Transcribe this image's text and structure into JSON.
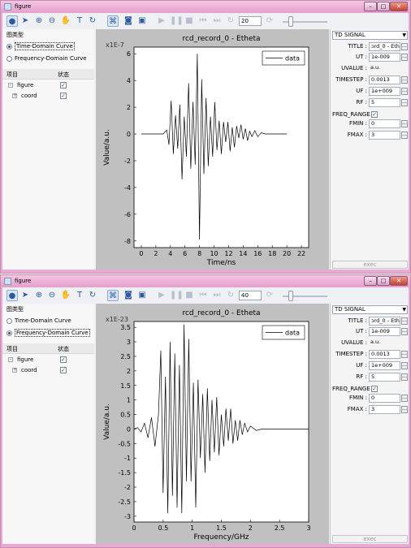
{
  "windows": [
    {
      "title": "figure",
      "zoom_value": "20",
      "group_label": "图类型",
      "radios": [
        {
          "label": "Time-Domain Curve",
          "selected": true,
          "focused": true
        },
        {
          "label": "Frequency-Domain Curve",
          "selected": false,
          "focused": false
        }
      ],
      "tree_headers": [
        "项目",
        "状态"
      ],
      "tree": [
        {
          "label": "figure",
          "checked": true
        },
        {
          "label": "coord",
          "checked": true
        }
      ],
      "signal_type": "TD SIGNAL",
      "props": [
        {
          "label": "TITLE :",
          "value": "ɔrd_0 - Etheta",
          "button": true
        },
        {
          "label": "UT :",
          "value": "1e-009",
          "button": true
        },
        {
          "label": "UVALUE :",
          "value": "a.u.",
          "button": false
        },
        {
          "label": "TIMESTEP :",
          "value": "0.0013",
          "button": true
        },
        {
          "label": "UF :",
          "value": "1e+009",
          "button": true
        },
        {
          "label": "RF :",
          "value": "5",
          "button": true
        },
        {
          "label": "FMIN :",
          "value": "0",
          "button": true
        },
        {
          "label": "FMAX :",
          "value": "3",
          "button": true
        }
      ],
      "freq_range_label": "FREQ_RANGE",
      "freq_range_checked": true,
      "exec_label": "exec",
      "chart_data": {
        "type": "line",
        "title": "rcd_record_0 - Etheta",
        "xlabel": "Time/ns",
        "ylabel": "Value/a.u.",
        "y_scale_label": "x1E-7",
        "xlim": [
          -1,
          23
        ],
        "ylim": [
          -8.5,
          6.5
        ],
        "xticks": [
          0,
          2,
          4,
          6,
          8,
          10,
          12,
          14,
          16,
          18,
          20,
          22
        ],
        "yticks": [
          -8,
          -6,
          -4,
          -2,
          0,
          2,
          4,
          6
        ],
        "legend": "top-right",
        "series": [
          {
            "name": "data",
            "color": "#000000",
            "x": [
              0,
              3.0,
              3.5,
              3.8,
              4.1,
              4.4,
              4.7,
              5.0,
              5.3,
              5.6,
              5.9,
              6.2,
              6.5,
              6.8,
              7.1,
              7.4,
              7.7,
              8.0,
              8.3,
              8.6,
              8.9,
              9.2,
              9.5,
              9.8,
              10.1,
              10.4,
              10.7,
              11.0,
              11.3,
              11.6,
              11.9,
              12.2,
              12.5,
              12.8,
              13.1,
              13.4,
              13.7,
              14.0,
              14.3,
              14.6,
              14.9,
              15.2,
              15.6,
              16.0,
              16.5,
              17.0,
              18.0,
              20.0
            ],
            "y": [
              0,
              0,
              0.3,
              -0.8,
              2.5,
              -1.5,
              1.4,
              -1.1,
              2.2,
              -3.4,
              1.3,
              -1.7,
              3.8,
              -2.6,
              2.4,
              -2.3,
              6.0,
              -7.9,
              4.1,
              -3.0,
              2.7,
              -2.4,
              1.3,
              -1.7,
              2.4,
              -1.2,
              1.0,
              -1.5,
              0.9,
              -0.6,
              0.9,
              -1.3,
              0.5,
              -1.0,
              0.6,
              -0.3,
              0.7,
              -0.4,
              0.4,
              -0.5,
              0.2,
              -0.2,
              0.25,
              -0.2,
              0.1,
              0,
              0,
              0
            ]
          }
        ]
      }
    },
    {
      "title": "figure",
      "zoom_value": "40",
      "group_label": "图类型",
      "radios": [
        {
          "label": "Time-Domain Curve",
          "selected": false,
          "focused": false
        },
        {
          "label": "Frequency-Domain Curve",
          "selected": true,
          "focused": true
        }
      ],
      "tree_headers": [
        "项目",
        "状态"
      ],
      "tree": [
        {
          "label": "figure",
          "checked": true
        },
        {
          "label": "coord",
          "checked": true
        }
      ],
      "signal_type": "TD SIGNAL",
      "props": [
        {
          "label": "TITLE :",
          "value": "ɔrd_0 - Etheta",
          "button": true
        },
        {
          "label": "UT :",
          "value": "1e-009",
          "button": true
        },
        {
          "label": "UVALUE :",
          "value": "a.u.",
          "button": false
        },
        {
          "label": "TIMESTEP :",
          "value": "0.0013",
          "button": true
        },
        {
          "label": "UF :",
          "value": "1e+009",
          "button": true
        },
        {
          "label": "RF :",
          "value": "5",
          "button": true
        },
        {
          "label": "FMIN :",
          "value": "0",
          "button": true
        },
        {
          "label": "FMAX :",
          "value": "3",
          "button": true
        }
      ],
      "freq_range_label": "FREQ_RANGE",
      "freq_range_checked": true,
      "exec_label": "exec",
      "chart_data": {
        "type": "line",
        "title": "rcd_record_0 - Etheta",
        "xlabel": "Frequency/GHz",
        "ylabel": "Value/a.u.",
        "y_scale_label": "x1E-23",
        "xlim": [
          0,
          3
        ],
        "ylim": [
          -3.2,
          3.7
        ],
        "xticks": [
          0,
          0.5,
          1,
          1.5,
          2,
          2.5,
          3
        ],
        "yticks": [
          -3,
          -2.5,
          -2,
          -1.5,
          -1,
          -0.5,
          0,
          0.5,
          1,
          1.5,
          2,
          2.5,
          3,
          3.5
        ],
        "legend": "top-right",
        "series": [
          {
            "name": "data",
            "color": "#000000",
            "x": [
              0,
              0.06,
              0.12,
              0.18,
              0.24,
              0.3,
              0.36,
              0.42,
              0.46,
              0.5,
              0.54,
              0.58,
              0.62,
              0.66,
              0.7,
              0.74,
              0.78,
              0.82,
              0.86,
              0.9,
              0.94,
              0.98,
              1.02,
              1.06,
              1.1,
              1.14,
              1.18,
              1.22,
              1.26,
              1.3,
              1.34,
              1.38,
              1.42,
              1.46,
              1.5,
              1.54,
              1.58,
              1.62,
              1.66,
              1.7,
              1.74,
              1.78,
              1.82,
              1.86,
              1.9,
              1.95,
              2.0,
              2.1,
              2.2,
              2.3,
              2.5,
              3.0
            ],
            "y": [
              0,
              0.05,
              -0.1,
              0.2,
              -0.3,
              0.4,
              -0.6,
              0.5,
              2.7,
              -2.2,
              1.8,
              -2.9,
              3.0,
              -2.3,
              2.6,
              -2.7,
              2.2,
              -2.9,
              3.6,
              -1.8,
              3.1,
              -1.8,
              1.6,
              -2.7,
              1.7,
              -1.0,
              1.2,
              -1.5,
              1.4,
              -1.1,
              1.0,
              -0.8,
              1.1,
              -0.9,
              0.5,
              -0.6,
              0.7,
              -0.4,
              0.7,
              -0.5,
              0.3,
              -0.4,
              0.3,
              -0.2,
              0.2,
              -0.1,
              0.1,
              -0.05,
              0,
              0,
              0,
              0
            ]
          }
        ]
      }
    }
  ]
}
